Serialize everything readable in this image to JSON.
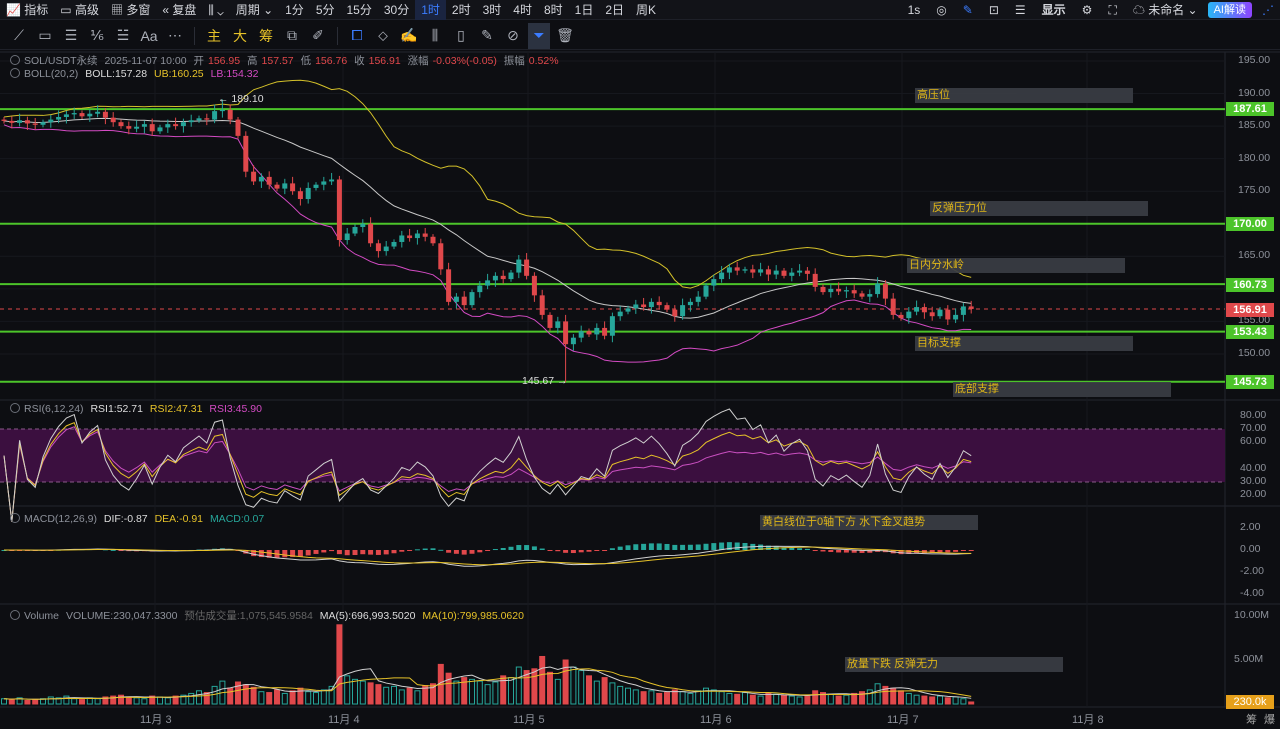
{
  "topbar": {
    "items": [
      "指标",
      "高级",
      "多窗",
      "复盘",
      "周期",
      "1分",
      "5分",
      "15分",
      "30分",
      "1时",
      "2时",
      "3时",
      "4时",
      "8时",
      "1日",
      "2日",
      "周K"
    ],
    "active": "1时",
    "right": {
      "interval": "1s",
      "display": "显示",
      "layout": "未命名",
      "ai": "AI解读"
    }
  },
  "drawbar": {
    "tools": [
      "line-tool",
      "rect-tool",
      "parallel-tool",
      "fib-tool",
      "hline-tool",
      "text-tool",
      "more-tool"
    ],
    "text_tools": [
      "主",
      "大",
      "筹"
    ]
  },
  "legend": {
    "symbol": "SOL/USDT永续",
    "datetime": "2025-11-07 10:00",
    "open_label": "开",
    "open": "156.95",
    "high_label": "高",
    "high": "157.57",
    "low_label": "低",
    "low": "156.76",
    "close_label": "收",
    "close": "156.91",
    "chg_label": "涨幅",
    "chg": "-0.03%(-0.05)",
    "amp_label": "振幅",
    "amp": "0.52%",
    "boll": "BOLL(20,2)",
    "boll_mid": "BOLL:157.28",
    "boll_ub": "UB:160.25",
    "boll_lb": "LB:154.32",
    "rsi": "RSI(6,12,24)",
    "rsi1": "RSI1:52.71",
    "rsi2": "RSI2:47.31",
    "rsi3": "RSI3:45.90",
    "macd": "MACD(12,26,9)",
    "dif": "DIF:-0.87",
    "dea": "DEA:-0.91",
    "macd_val": "MACD:0.07",
    "vol": "Volume",
    "vol_val": "VOLUME:230,047.3300",
    "vol_est": "预估成交量:1,075,545.9584",
    "ma5": "MA(5):696,993.5020",
    "ma10": "MA(10):799,985.0620"
  },
  "annotations": {
    "high_label": "← 189.10",
    "low_label": "145.67 →",
    "notes": [
      {
        "text": "高压位",
        "price": 187.61
      },
      {
        "text": "反弹压力位",
        "price": 170.0
      },
      {
        "text": "日内分水岭",
        "price": 160.73
      },
      {
        "text": "目标支撑",
        "price": 153.43
      },
      {
        "text": "底部支撑",
        "price": 145.73
      }
    ],
    "macd_note": "黄白线位于0轴下方 水下金叉趋势",
    "vol_note": "放量下跌 反弹无力"
  },
  "price_axis": {
    "ticks": [
      "195.00",
      "190.00",
      "185.00",
      "180.00",
      "175.00",
      "170.00",
      "165.00",
      "160.00",
      "155.00",
      "150.00"
    ],
    "levels": [
      "187.61",
      "170.00",
      "160.73",
      "153.43",
      "145.73"
    ],
    "last": "156.91"
  },
  "rsi_axis": [
    "80.00",
    "70.00",
    "60.00",
    "40.00",
    "30.00",
    "20.00"
  ],
  "macd_axis": [
    "2.00",
    "0.00",
    "-2.00",
    "-4.00"
  ],
  "vol_axis": [
    "10.00M",
    "5.00M"
  ],
  "vol_last": "230.0k",
  "time_axis": [
    "11月 3",
    "11月 4",
    "11月 5",
    "11月 6",
    "11月 7",
    "11月 8"
  ],
  "bottom_right": [
    "筹",
    "爆"
  ],
  "colors": {
    "up": "#26a69a",
    "down": "#e0484b",
    "level": "#4cc42a",
    "boll_mid": "#c8c8c8",
    "boll_ub": "#d4c12a",
    "boll_lb": "#d44bc4",
    "rsi_band": "#3b0f3f"
  },
  "chart_data": {
    "type": "candlestick",
    "interval": "1h",
    "start": "11月2 04:00",
    "ylim": [
      144,
      196
    ],
    "close": [
      185.8,
      185.5,
      185.9,
      185.4,
      185.2,
      185.6,
      186.0,
      186.4,
      186.8,
      187.0,
      186.5,
      186.9,
      187.2,
      186.3,
      185.6,
      185.0,
      184.6,
      184.9,
      185.3,
      184.2,
      184.8,
      185.3,
      185.0,
      185.6,
      185.9,
      186.2,
      186.0,
      187.3,
      187.5,
      186.0,
      183.5,
      178.0,
      176.5,
      177.2,
      176.0,
      175.4,
      176.2,
      175.0,
      173.8,
      175.5,
      176.0,
      176.5,
      176.8,
      167.5,
      168.5,
      169.5,
      170.0,
      167.0,
      165.8,
      166.5,
      167.2,
      168.2,
      167.8,
      168.5,
      168.0,
      167.0,
      163.0,
      158.0,
      158.8,
      157.5,
      159.5,
      160.5,
      161.3,
      162.0,
      161.5,
      162.5,
      164.5,
      162.0,
      159.0,
      156.0,
      154.0,
      155.0,
      151.5,
      152.5,
      153.5,
      153.0,
      154.0,
      152.8,
      155.8,
      156.5,
      157.0,
      157.6,
      157.2,
      158.0,
      157.5,
      156.8,
      155.8,
      157.5,
      158.0,
      158.8,
      160.5,
      161.5,
      162.5,
      163.3,
      162.8,
      163.0,
      162.5,
      163.0,
      162.2,
      162.8,
      162.0,
      162.5,
      162.8,
      162.3,
      160.3,
      159.5,
      160.0,
      159.6,
      159.8,
      159.3,
      158.8,
      159.2,
      160.8,
      158.5,
      156.0,
      155.5,
      156.5,
      157.2,
      156.4,
      155.8,
      156.8,
      155.3,
      156.0,
      157.3,
      156.91
    ],
    "volume_m": [
      0.6,
      0.5,
      0.7,
      0.4,
      0.5,
      0.6,
      0.8,
      0.7,
      0.9,
      0.6,
      0.5,
      0.7,
      0.6,
      0.8,
      0.9,
      1.0,
      0.8,
      0.7,
      0.6,
      0.9,
      0.8,
      0.7,
      0.9,
      1.0,
      1.2,
      1.5,
      1.3,
      2.0,
      2.6,
      1.8,
      2.5,
      2.2,
      1.9,
      1.4,
      1.3,
      1.6,
      1.2,
      1.5,
      1.8,
      1.4,
      1.3,
      1.6,
      2.0,
      9.0,
      3.2,
      2.8,
      2.6,
      2.4,
      2.2,
      1.9,
      2.0,
      1.6,
      1.8,
      1.5,
      2.1,
      2.3,
      4.5,
      3.5,
      2.6,
      3.0,
      2.8,
      2.6,
      2.2,
      2.5,
      3.2,
      3.0,
      4.2,
      3.8,
      4.0,
      5.4,
      3.6,
      2.8,
      5.0,
      4.2,
      3.8,
      3.2,
      2.6,
      3.0,
      2.4,
      2.0,
      1.8,
      1.6,
      1.4,
      1.5,
      1.2,
      1.3,
      1.6,
      1.4,
      1.2,
      1.5,
      1.8,
      1.6,
      1.4,
      1.2,
      1.1,
      1.3,
      1.0,
      0.9,
      1.2,
      1.1,
      1.0,
      0.9,
      0.8,
      1.0,
      1.5,
      1.3,
      1.1,
      0.9,
      1.0,
      1.2,
      1.4,
      1.6,
      2.3,
      2.0,
      1.8,
      1.5,
      1.2,
      1.0,
      0.9,
      0.8,
      0.9,
      0.7,
      0.8,
      0.6,
      0.23
    ],
    "high": 189.1,
    "low": 145.67
  }
}
